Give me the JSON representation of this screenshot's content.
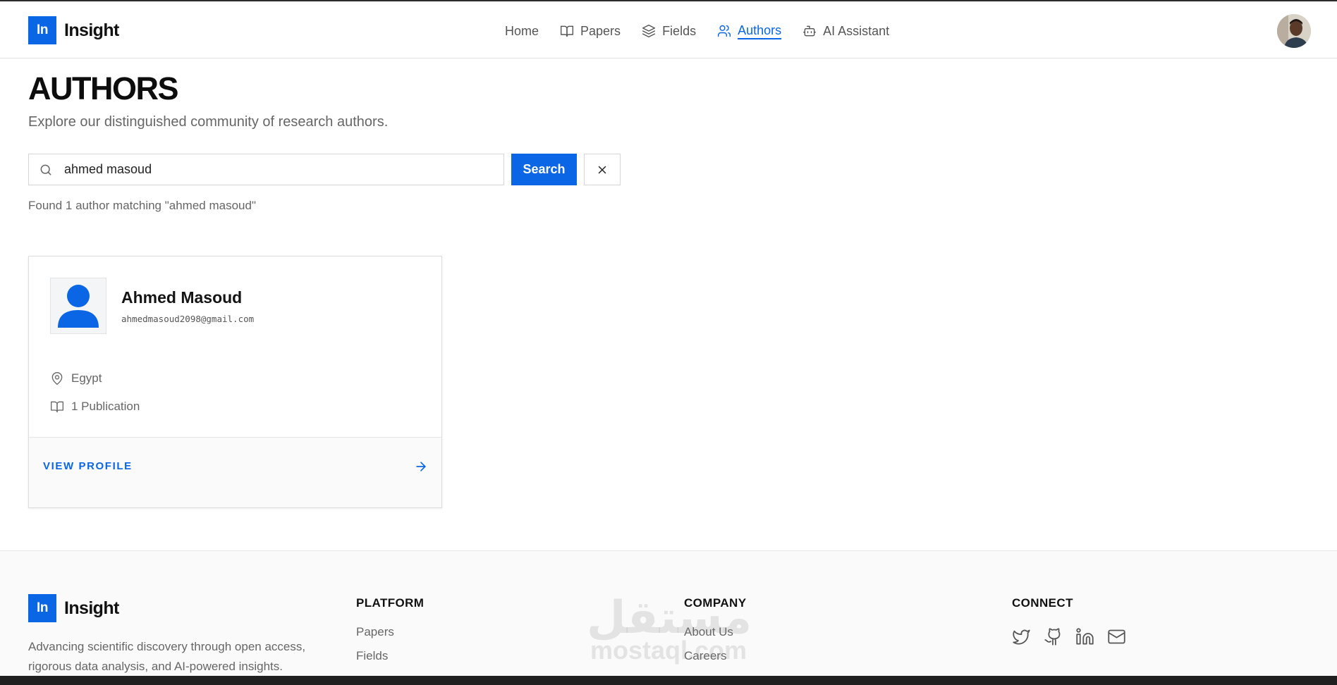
{
  "header": {
    "logo_badge": "In",
    "logo_text": "Insight",
    "nav": [
      {
        "label": "Home",
        "icon": "none"
      },
      {
        "label": "Papers",
        "icon": "book-open-icon"
      },
      {
        "label": "Fields",
        "icon": "layers-icon"
      },
      {
        "label": "Authors",
        "icon": "users-icon",
        "active": true
      },
      {
        "label": "AI Assistant",
        "icon": "bot-icon"
      }
    ]
  },
  "page": {
    "title": "AUTHORS",
    "subtitle": "Explore our distinguished community of research authors."
  },
  "search": {
    "value": "ahmed masoud",
    "button_label": "Search",
    "result_text": "Found 1 author matching \"ahmed masoud\""
  },
  "authors": [
    {
      "name": "Ahmed Masoud",
      "email": "ahmedmasoud2098@gmail.com",
      "location": "Egypt",
      "publications": "1 Publication",
      "cta": "VIEW PROFILE"
    }
  ],
  "footer": {
    "logo_badge": "In",
    "logo_text": "Insight",
    "description": "Advancing scientific discovery through open access, rigorous data analysis, and AI-powered insights.",
    "platform": {
      "heading": "PLATFORM",
      "links": [
        "Papers",
        "Fields"
      ]
    },
    "company": {
      "heading": "COMPANY",
      "links": [
        "About Us",
        "Careers"
      ]
    },
    "connect": {
      "heading": "CONNECT",
      "icons": [
        "twitter-icon",
        "github-icon",
        "linkedin-icon",
        "mail-icon"
      ]
    }
  },
  "watermark": {
    "arabic": "مستقل",
    "latin": "mostaql.com"
  },
  "colors": {
    "accent": "#0a66e4",
    "muted_text": "#666666",
    "border": "#dcdcdc"
  }
}
